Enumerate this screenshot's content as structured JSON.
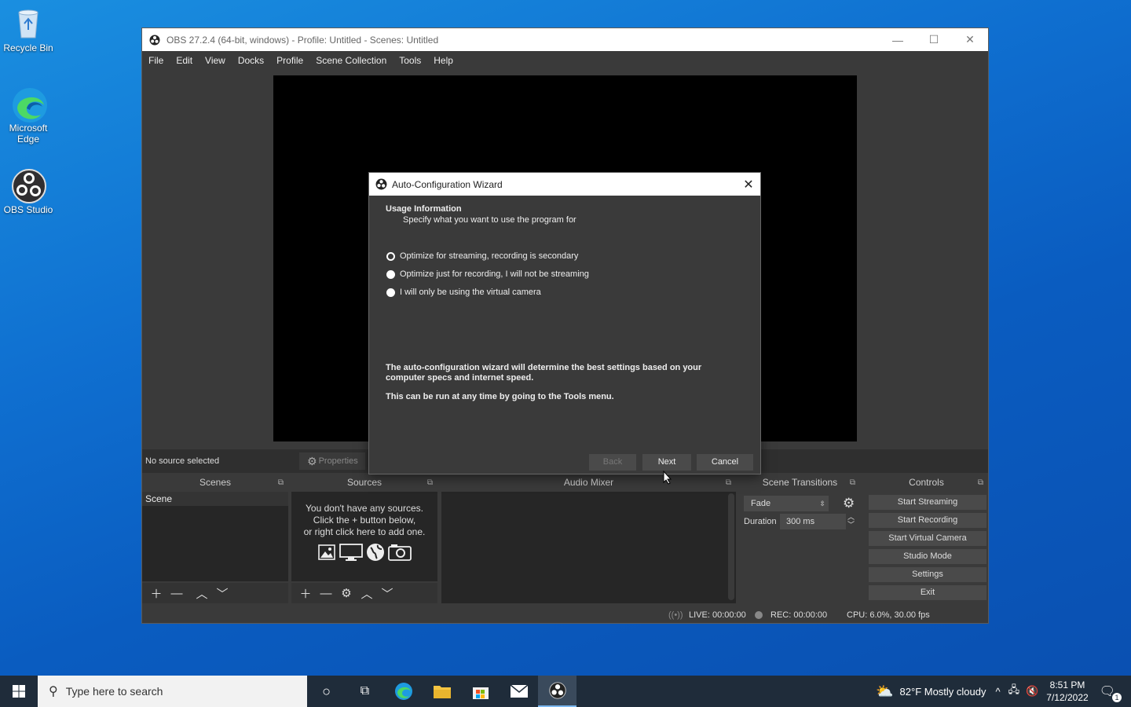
{
  "desktop": {
    "icons": [
      {
        "label": "Recycle Bin",
        "icon": "recycle-bin-icon"
      },
      {
        "label": "Microsoft Edge",
        "icon": "edge-icon"
      },
      {
        "label": "OBS Studio",
        "icon": "obs-icon"
      }
    ]
  },
  "obs": {
    "title": "OBS 27.2.4 (64-bit, windows) - Profile: Untitled - Scenes: Untitled",
    "menu": [
      "File",
      "Edit",
      "View",
      "Docks",
      "Profile",
      "Scene Collection",
      "Tools",
      "Help"
    ],
    "no_source": "No source selected",
    "properties": "Properties",
    "docks": {
      "scenes": "Scenes",
      "sources": "Sources",
      "audio_mixer": "Audio Mixer",
      "scene_transitions": "Scene Transitions",
      "controls": "Controls"
    },
    "scene_item": "Scene",
    "sources_msg": [
      "You don't have any sources.",
      "Click the + button below,",
      "or right click here to add one."
    ],
    "transition": {
      "name": "Fade",
      "duration_label": "Duration",
      "duration": "300 ms"
    },
    "controls": [
      "Start Streaming",
      "Start Recording",
      "Start Virtual Camera",
      "Studio Mode",
      "Settings",
      "Exit"
    ],
    "status": {
      "live": "LIVE: 00:00:00",
      "rec": "REC: 00:00:00",
      "cpu": "CPU: 6.0%, 30.00 fps"
    }
  },
  "wizard": {
    "title": "Auto-Configuration Wizard",
    "heading": "Usage Information",
    "subheading": "Specify what you want to use the program for",
    "options": [
      "Optimize for streaming, recording is secondary",
      "Optimize just for recording, I will not be streaming",
      "I will only be using the virtual camera"
    ],
    "selected": 0,
    "info1": "The auto-configuration wizard will determine the best settings based on your computer specs and internet speed.",
    "info2": "This can be run at any time by going to the Tools menu.",
    "back": "Back",
    "next": "Next",
    "cancel": "Cancel"
  },
  "taskbar": {
    "search_placeholder": "Type here to search",
    "weather": "82°F  Mostly cloudy",
    "time": "8:51 PM",
    "date": "7/12/2022",
    "notification_count": "1"
  }
}
